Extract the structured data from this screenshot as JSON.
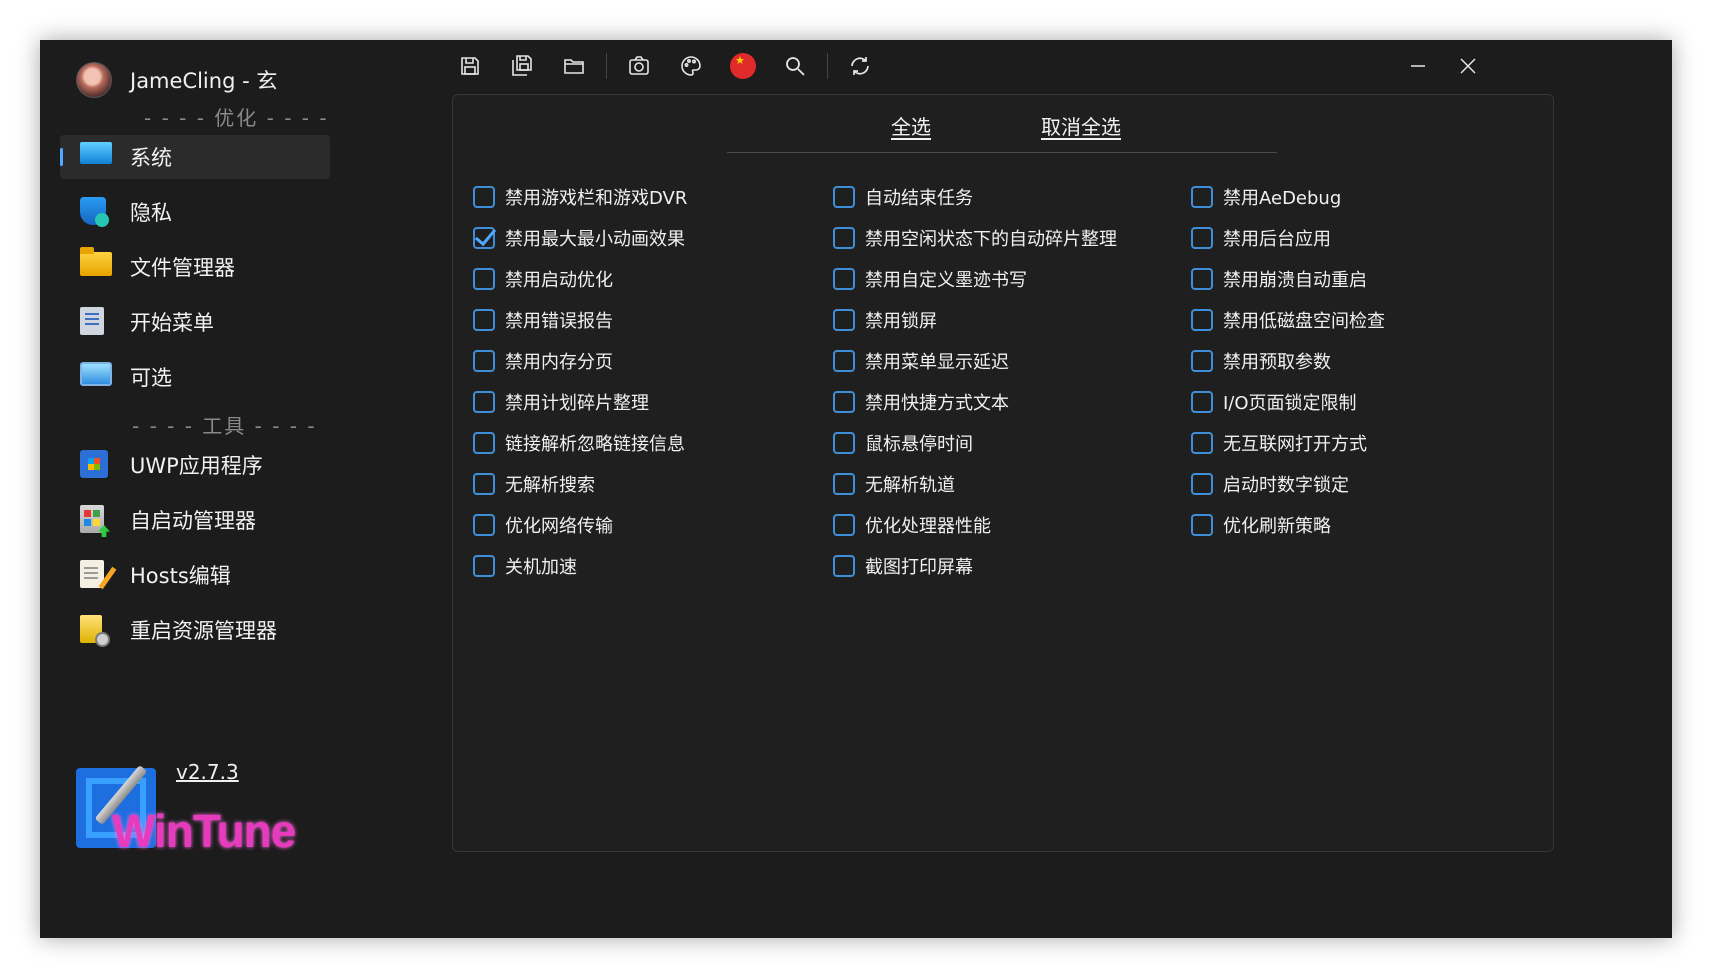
{
  "user": {
    "name": "JameCling - 玄"
  },
  "sections": {
    "optimize": "- - - - 优化 - - - -",
    "tools": "- - - - 工具 - - - -"
  },
  "nav": {
    "system": "系统",
    "privacy": "隐私",
    "file_manager": "文件管理器",
    "start_menu": "开始菜单",
    "optional": "可选",
    "uwp": "UWP应用程序",
    "autostart": "自启动管理器",
    "hosts": "Hosts编辑",
    "restart_explorer": "重启资源管理器"
  },
  "brand": {
    "name": "WinTune",
    "version": "v2.7.3"
  },
  "toolbar": {
    "icons": [
      "save-icon",
      "save-all-icon",
      "folder-open-icon",
      "camera-icon",
      "palette-icon",
      "china-flag-icon",
      "search-icon",
      "refresh-icon"
    ]
  },
  "panel": {
    "select_all": "全选",
    "deselect_all": "取消全选",
    "columns": [
      [
        {
          "label": "禁用游戏栏和游戏DVR",
          "checked": false
        },
        {
          "label": "禁用最大最小动画效果",
          "checked": true
        },
        {
          "label": "禁用启动优化",
          "checked": false
        },
        {
          "label": "禁用错误报告",
          "checked": false
        },
        {
          "label": "禁用内存分页",
          "checked": false
        },
        {
          "label": "禁用计划碎片整理",
          "checked": false
        },
        {
          "label": "链接解析忽略链接信息",
          "checked": false
        },
        {
          "label": "无解析搜索",
          "checked": false
        },
        {
          "label": "优化网络传输",
          "checked": false
        },
        {
          "label": "关机加速",
          "checked": false
        }
      ],
      [
        {
          "label": "自动结束任务",
          "checked": false
        },
        {
          "label": "禁用空闲状态下的自动碎片整理",
          "checked": false
        },
        {
          "label": "禁用自定义墨迹书写",
          "checked": false
        },
        {
          "label": "禁用锁屏",
          "checked": false
        },
        {
          "label": "禁用菜单显示延迟",
          "checked": false
        },
        {
          "label": "禁用快捷方式文本",
          "checked": false
        },
        {
          "label": "鼠标悬停时间",
          "checked": false
        },
        {
          "label": "无解析轨道",
          "checked": false
        },
        {
          "label": "优化处理器性能",
          "checked": false
        },
        {
          "label": "截图打印屏幕",
          "checked": false
        }
      ],
      [
        {
          "label": "禁用AeDebug",
          "checked": false
        },
        {
          "label": "禁用后台应用",
          "checked": false
        },
        {
          "label": "禁用崩溃自动重启",
          "checked": false
        },
        {
          "label": "禁用低磁盘空间检查",
          "checked": false
        },
        {
          "label": "禁用预取参数",
          "checked": false
        },
        {
          "label": "I/O页面锁定限制",
          "checked": false
        },
        {
          "label": "无互联网打开方式",
          "checked": false
        },
        {
          "label": "启动时数字锁定",
          "checked": false
        },
        {
          "label": "优化刷新策略",
          "checked": false
        }
      ]
    ]
  },
  "colors": {
    "accent": "#4fa9ff",
    "window_bg": "#1c1c1c",
    "brand_pink": "#e63bbd"
  }
}
